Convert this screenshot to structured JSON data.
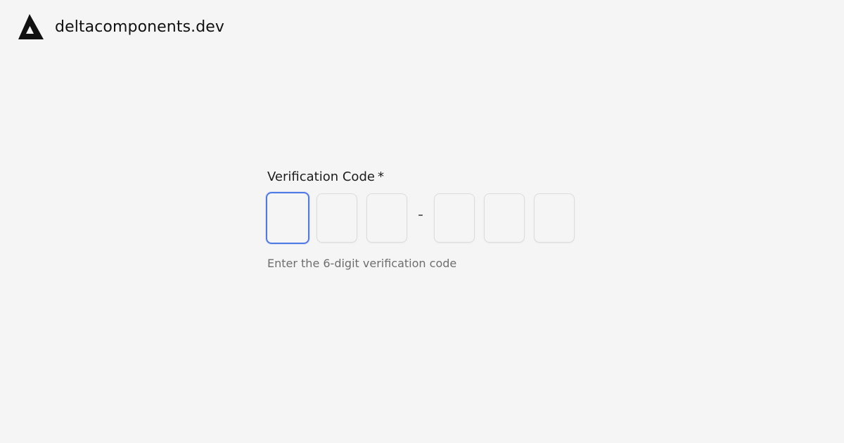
{
  "brand": {
    "logo_icon": "delta-logo-icon",
    "name": "deltacomponents.dev"
  },
  "form": {
    "label": "Verification Code",
    "required_mark": "*",
    "hint": "Enter the 6-digit verification code",
    "separator": "-",
    "digits": [
      "",
      "",
      "",
      "",
      "",
      ""
    ],
    "focused_index": 0,
    "colors": {
      "background": "#f5f5f5",
      "focus_border": "#4f7ae4",
      "border": "#dcdcdc",
      "text": "#1c1c1c",
      "hint_text": "#6e6e6e"
    }
  }
}
